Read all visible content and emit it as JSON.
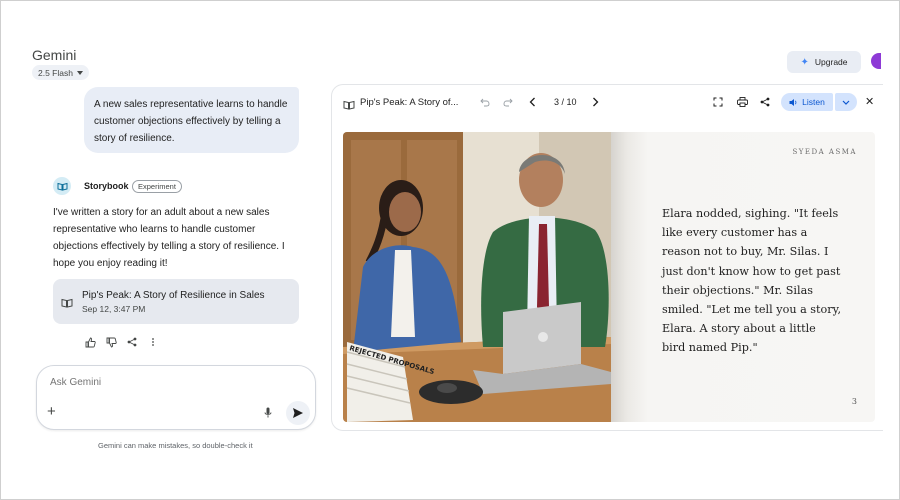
{
  "header": {
    "app_title": "Gemini",
    "model": "2.5 Flash",
    "upgrade_label": "Upgrade"
  },
  "chat": {
    "user_message": "A new sales representative learns to handle customer objections effectively by telling a story of resilience.",
    "bot_name": "Storybook",
    "bot_badge": "Experiment",
    "reply": "I've written a story for an adult about a new sales representative who learns to handle customer objections effectively by telling a story of resilience. I hope you enjoy reading it!",
    "story_card": {
      "title": "Pip's Peak: A Story of Resilience in Sales",
      "date": "Sep 12, 3:47 PM"
    }
  },
  "input": {
    "placeholder": "Ask Gemini",
    "disclaimer": "Gemini can make mistakes, so double-check it"
  },
  "storybook": {
    "title": "Pip's Peak: A Story of...",
    "page_counter": "3 / 10",
    "listen_label": "Listen",
    "author": "SYEDA ASMA",
    "page_text": "Elara nodded, sighing. \"It feels like every customer has a reason not to buy, Mr. Silas. I just don't know how to get past their objections.\" Mr. Silas smiled. \"Let me tell you a story, Elara. A story about a little bird named Pip.\"",
    "page_number": "3",
    "illustration_papers_text": "REJECTED PROPOSALS"
  },
  "colors": {
    "accent": "#0b57d0",
    "listen_bg": "#d3e3fd",
    "bubble_bg": "#e8edf6",
    "avatar": "#8e3ad6"
  },
  "icons": {
    "storybook": "open-book-icon",
    "upgrade": "sparkle-icon",
    "feedback": [
      "thumbs-up-icon",
      "thumbs-down-icon",
      "share-icon",
      "more-vert-icon"
    ],
    "toolbar": [
      "undo-icon",
      "redo-icon",
      "chevron-left-icon",
      "chevron-right-icon",
      "fullscreen-icon",
      "print-icon",
      "share-icon",
      "close-icon"
    ]
  }
}
